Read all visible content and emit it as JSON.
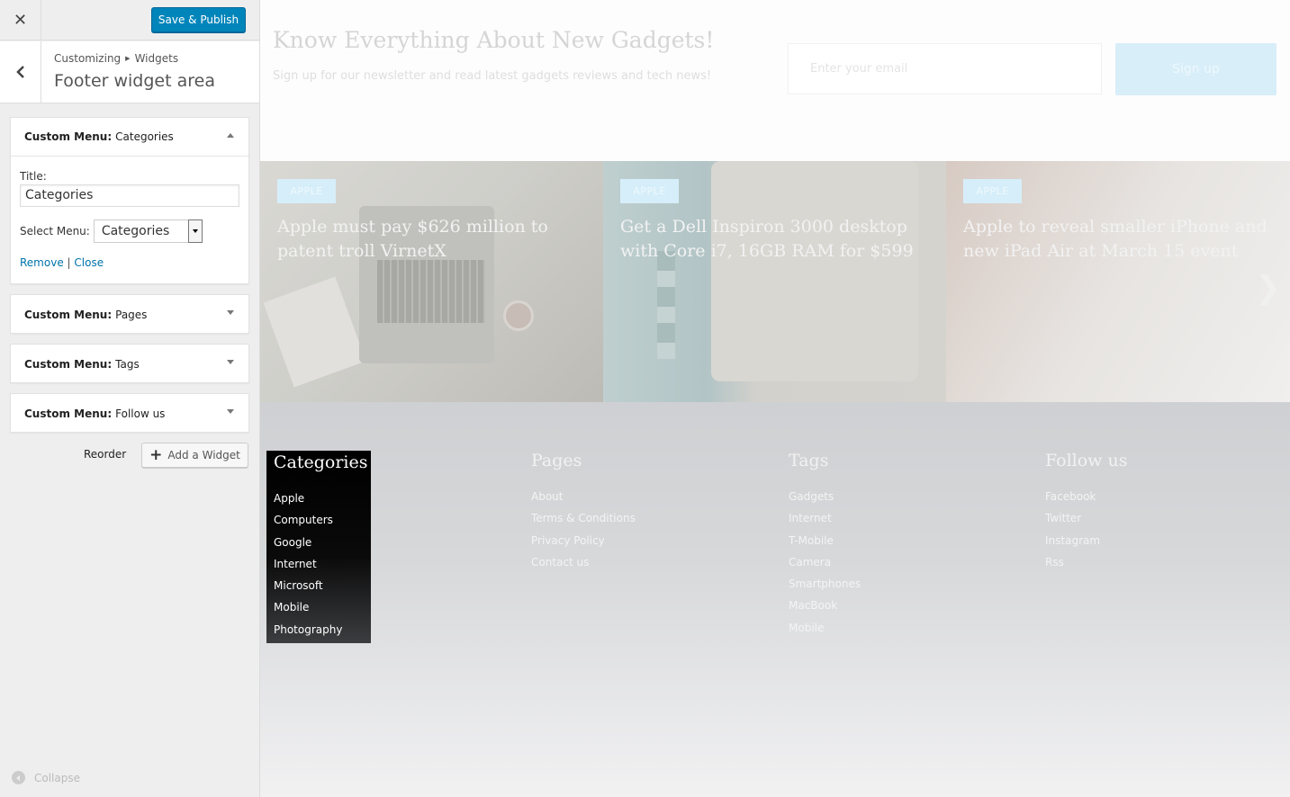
{
  "sidebar": {
    "close_icon": "close-icon",
    "publish_label": "Save & Publish",
    "breadcrumb": {
      "root": "Customizing",
      "section": "Widgets"
    },
    "panel_title": "Footer widget area",
    "widgets": [
      {
        "type": "Custom Menu:",
        "name": "Categories",
        "expanded": true
      },
      {
        "type": "Custom Menu:",
        "name": "Pages",
        "expanded": false
      },
      {
        "type": "Custom Menu:",
        "name": "Tags",
        "expanded": false
      },
      {
        "type": "Custom Menu:",
        "name": "Follow us",
        "expanded": false
      }
    ],
    "form": {
      "title_label": "Title:",
      "title_value": "Categories",
      "select_label": "Select Menu:",
      "select_value": "Categories",
      "remove_label": "Remove",
      "separator": "|",
      "close_label": "Close"
    },
    "reorder_label": "Reorder",
    "add_widget_label": "Add a Widget",
    "collapse_label": "Collapse"
  },
  "preview": {
    "newsletter": {
      "title": "Know Everything About New Gadgets!",
      "subtitle": "Sign up for our newsletter and read latest gadgets reviews and tech news!",
      "email_placeholder": "Enter your email",
      "signup_label": "Sign up"
    },
    "slides": [
      {
        "badge": "APPLE",
        "title": "Apple must pay $626 million to patent troll VirnetX"
      },
      {
        "badge": "APPLE",
        "title": "Get a Dell Inspiron 3000 desktop with Core i7, 16GB RAM for $599"
      },
      {
        "badge": "APPLE",
        "title": "Apple to reveal smaller iPhone and new iPad Air at March 15 event"
      }
    ],
    "footer": {
      "categories": {
        "title": "Categories",
        "items": [
          "Apple",
          "Computers",
          "Google",
          "Internet",
          "Microsoft",
          "Mobile",
          "Photography"
        ]
      },
      "pages": {
        "title": "Pages",
        "items": [
          "About",
          "Terms & Conditions",
          "Privacy Policy",
          "Contact us"
        ]
      },
      "tags": {
        "title": "Tags",
        "items": [
          "Gadgets",
          "Internet",
          "T-Mobile",
          "Camera",
          "Smartphones",
          "MacBook",
          "Mobile"
        ]
      },
      "follow": {
        "title": "Follow us",
        "items": [
          "Facebook",
          "Twitter",
          "Instagram",
          "Rss"
        ]
      }
    }
  },
  "colors": {
    "accent": "#0085ba",
    "link": "#0073aa"
  }
}
